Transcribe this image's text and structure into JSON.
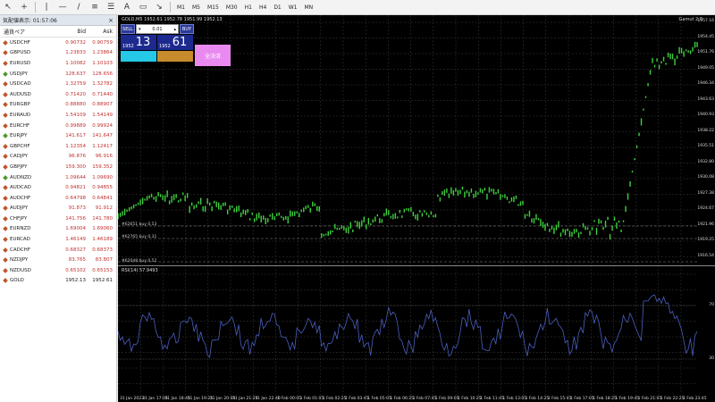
{
  "toolbar": {
    "timeframes": [
      "M1",
      "M5",
      "M15",
      "M30",
      "H1",
      "H4",
      "D1",
      "W1",
      "MN"
    ]
  },
  "watchlist": {
    "title": "気配値表示: 01:57:06",
    "headers": {
      "symbol": "通貨ペア",
      "bid": "Bid",
      "ask": "Ask"
    },
    "rows": [
      {
        "symbol": "USDCHF",
        "bid": "0.90732",
        "ask": "0.90759",
        "dir": "down"
      },
      {
        "symbol": "GBPUSD",
        "bid": "1.23833",
        "ask": "1.23864",
        "dir": "down"
      },
      {
        "symbol": "EURUSD",
        "bid": "1.10082",
        "ask": "1.10103",
        "dir": "down"
      },
      {
        "symbol": "USDJPY",
        "bid": "128.637",
        "ask": "128.656",
        "dir": "up"
      },
      {
        "symbol": "USDCAD",
        "bid": "1.32759",
        "ask": "1.32782",
        "dir": "down"
      },
      {
        "symbol": "AUDUSD",
        "bid": "0.71420",
        "ask": "0.71440",
        "dir": "down"
      },
      {
        "symbol": "EURGBP",
        "bid": "0.88880",
        "ask": "0.88907",
        "dir": "down"
      },
      {
        "symbol": "EURAUD",
        "bid": "1.54109",
        "ask": "1.54149",
        "dir": "down"
      },
      {
        "symbol": "EURCHF",
        "bid": "0.99889",
        "ask": "0.99924",
        "dir": "down"
      },
      {
        "symbol": "EURJPY",
        "bid": "141.617",
        "ask": "141.647",
        "dir": "up"
      },
      {
        "symbol": "GBPCHF",
        "bid": "1.12354",
        "ask": "1.12417",
        "dir": "down"
      },
      {
        "symbol": "CADJPY",
        "bid": "96.876",
        "ask": "96.916",
        "dir": "down"
      },
      {
        "symbol": "GBPJPY",
        "bid": "159.300",
        "ask": "159.352",
        "dir": "down"
      },
      {
        "symbol": "AUDNZD",
        "bid": "1.09644",
        "ask": "1.09690",
        "dir": "up"
      },
      {
        "symbol": "AUDCAD",
        "bid": "0.94821",
        "ask": "0.94855",
        "dir": "down"
      },
      {
        "symbol": "AUDCHF",
        "bid": "0.64798",
        "ask": "0.64841",
        "dir": "down"
      },
      {
        "symbol": "AUDJPY",
        "bid": "91.873",
        "ask": "91.912",
        "dir": "down"
      },
      {
        "symbol": "CHFJPY",
        "bid": "141.756",
        "ask": "141.780",
        "dir": "down"
      },
      {
        "symbol": "EURNZD",
        "bid": "1.69004",
        "ask": "1.69060",
        "dir": "down"
      },
      {
        "symbol": "EURCAD",
        "bid": "1.46149",
        "ask": "1.46189",
        "dir": "down"
      },
      {
        "symbol": "CADCHF",
        "bid": "0.68327",
        "ask": "0.68373",
        "dir": "down"
      },
      {
        "symbol": "NZDJPY",
        "bid": "83.765",
        "ask": "83.807",
        "dir": "down"
      },
      {
        "symbol": "NZDUSD",
        "bid": "0.65102",
        "ask": "0.65153",
        "dir": "down"
      },
      {
        "symbol": "GOLD",
        "bid": "1952.13",
        "ask": "1952.61",
        "dir": "down"
      }
    ]
  },
  "chart": {
    "title": "GOLD,M5 1952.61 1952.78 1951.99 1952.13",
    "brand": "Gamut 2.0",
    "rsi_title": "RSI(14) 57.9493",
    "trade": {
      "sell": "SELL",
      "buy": "BUY",
      "lot": "0.01",
      "sell_small": "1952",
      "sell_big": "13",
      "buy_small": "1952",
      "buy_big": "61",
      "close_all": "全決済"
    },
    "price_labels": [
      "1957.16",
      "1954.45",
      "1951.76",
      "1949.05",
      "1946.34",
      "1943.63",
      "1940.93",
      "1938.22",
      "1935.51",
      "1932.80",
      "1930.08",
      "1927.38",
      "1924.67",
      "1921.96",
      "1919.25",
      "1916.54"
    ],
    "rsi_labels": [
      "70",
      "30"
    ],
    "time_labels": [
      "31 Jan 2023",
      "31 Jan 17:05",
      "31 Jan 18:45",
      "31 Jan 19:25",
      "31 Jan 20:05",
      "31 Jan 21:25",
      "31 Jan 22:40",
      "1 Feb 00:05",
      "1 Feb 01:05",
      "1 Feb 02:25",
      "1 Feb 03:45",
      "1 Feb 05:05",
      "1 Feb 06:25",
      "1 Feb 07:45",
      "1 Feb 09:05",
      "1 Feb 10:25",
      "1 Feb 11:45",
      "1 Feb 13:05",
      "1 Feb 14:25",
      "1 Feb 15:45",
      "1 Feb 17:05",
      "1 Feb 18:25",
      "1 Feb 19:45",
      "1 Feb 21:05",
      "1 Feb 22:25",
      "1 Feb 23:45"
    ],
    "orders": [
      "#62651 buy 0.53",
      "#62765 buy 0.31",
      "#62048 buy 0.52"
    ],
    "colors": {
      "candles": "#3fd13f",
      "rsi": "#4a5fbf",
      "grid": "#3a3a3a"
    }
  }
}
